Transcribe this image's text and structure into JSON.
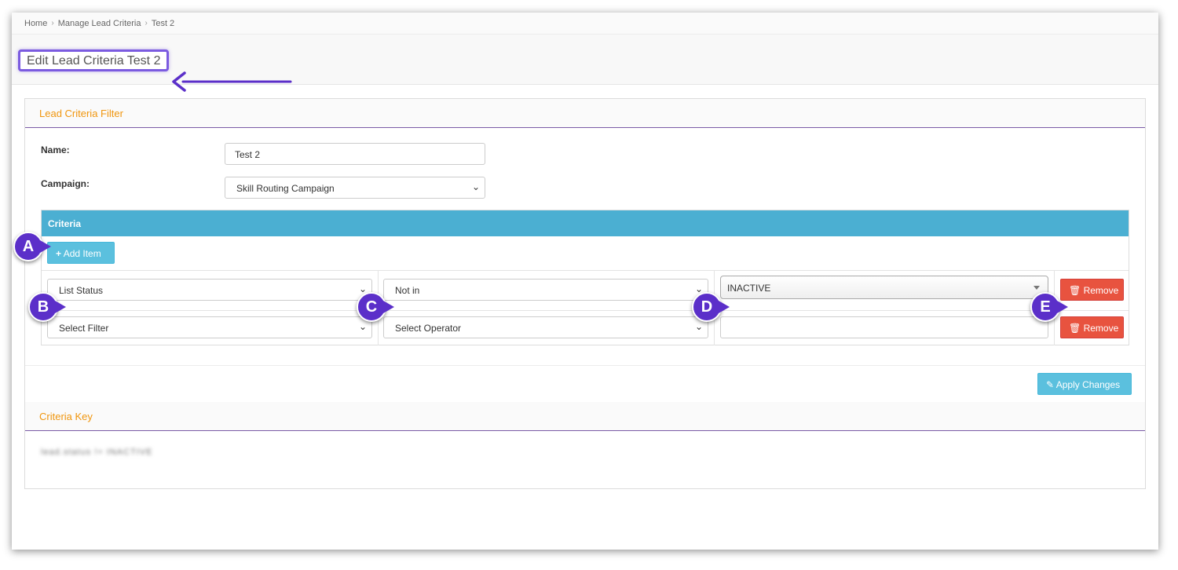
{
  "breadcrumb": {
    "home": "Home",
    "manage": "Manage Lead Criteria",
    "current": "Test 2"
  },
  "page_title": "Edit Lead Criteria Test 2",
  "filter_panel": {
    "heading": "Lead Criteria Filter",
    "name_label": "Name:",
    "name_value": "Test 2",
    "campaign_label": "Campaign:",
    "campaign_value": "Skill Routing Campaign"
  },
  "criteria": {
    "header": "Criteria",
    "add_item_label": "Add Item",
    "rows": [
      {
        "filter": "List Status",
        "operator": "Not in",
        "value": "INACTIVE",
        "remove_label": "Remove"
      },
      {
        "filter": "Select Filter",
        "operator": "Select Operator",
        "value": "",
        "remove_label": "Remove"
      }
    ]
  },
  "apply_changes_label": "Apply Changes",
  "criteria_key": {
    "heading": "Criteria Key",
    "text": "lead.status != INACTIVE"
  },
  "annotations": {
    "a": "A",
    "b": "B",
    "c": "C",
    "d": "D",
    "e": "E"
  },
  "colors": {
    "accent_orange": "#f0960e",
    "criteria_header": "#4bafd2",
    "annotation_purple": "#5b2fc9",
    "remove_red": "#e8533f"
  }
}
